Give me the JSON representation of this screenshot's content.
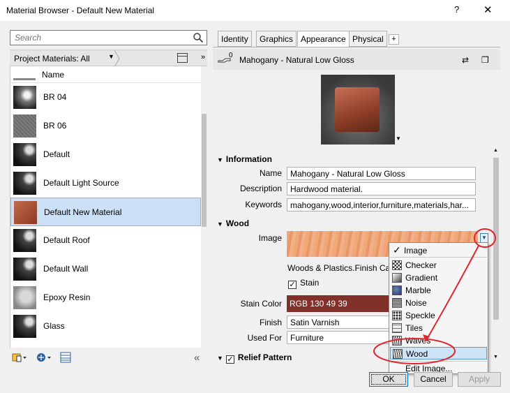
{
  "window": {
    "title": "Material Browser - Default New Material",
    "help": "?",
    "close": "✕"
  },
  "left": {
    "search_placeholder": "Search",
    "project_label": "Project Materials: All",
    "column_name": "Name",
    "materials": [
      {
        "name": "BR 04"
      },
      {
        "name": "BR 06"
      },
      {
        "name": "Default"
      },
      {
        "name": "Default Light Source"
      },
      {
        "name": "Default New Material",
        "selected": true
      },
      {
        "name": "Default Roof"
      },
      {
        "name": "Default Wall"
      },
      {
        "name": "Epoxy Resin"
      },
      {
        "name": "Glass"
      }
    ]
  },
  "tabs": [
    "Identity",
    "Graphics",
    "Appearance",
    "Physical",
    "+"
  ],
  "active_tab": "Appearance",
  "material": {
    "count": "0",
    "name": "Mahogany - Natural Low Gloss"
  },
  "information": {
    "header": "Information",
    "name_label": "Name",
    "name_value": "Mahogany - Natural Low Gloss",
    "description_label": "Description",
    "description_value": "Hardwood material.",
    "keywords_label": "Keywords",
    "keywords_value": "mahogany,wood,interior,furniture,materials,har..."
  },
  "wood": {
    "header": "Wood",
    "image_label": "Image",
    "image_caption": "Woods & Plastics.Finish Car",
    "stain_checkbox_label": "Stain",
    "stain_color_label": "Stain Color",
    "stain_color_value": "RGB 130 49 39",
    "finish_label": "Finish",
    "finish_value": "Satin Varnish",
    "used_for_label": "Used For",
    "used_for_value": "Furniture"
  },
  "relief": {
    "header": "Relief Pattern"
  },
  "menu": {
    "items": [
      "Image",
      "Checker",
      "Gradient",
      "Marble",
      "Noise",
      "Speckle",
      "Tiles",
      "Waves",
      "Wood",
      "Edit Image..."
    ],
    "highlighted": "Wood"
  },
  "buttons": {
    "ok": "OK",
    "cancel": "Cancel",
    "apply": "Apply"
  },
  "colors": {
    "selection": "#cce0f5",
    "stain": "#82312a",
    "annotation": "#e0252b",
    "accent": "#0078d7"
  }
}
